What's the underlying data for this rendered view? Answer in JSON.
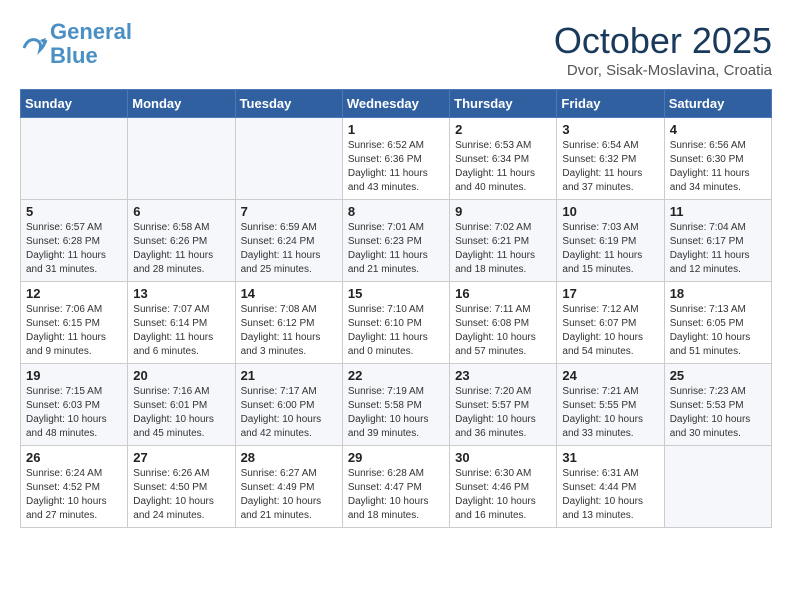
{
  "header": {
    "logo_line1": "General",
    "logo_line2": "Blue",
    "month": "October 2025",
    "location": "Dvor, Sisak-Moslavina, Croatia"
  },
  "weekdays": [
    "Sunday",
    "Monday",
    "Tuesday",
    "Wednesday",
    "Thursday",
    "Friday",
    "Saturday"
  ],
  "weeks": [
    [
      {
        "day": "",
        "info": ""
      },
      {
        "day": "",
        "info": ""
      },
      {
        "day": "",
        "info": ""
      },
      {
        "day": "1",
        "info": "Sunrise: 6:52 AM\nSunset: 6:36 PM\nDaylight: 11 hours and 43 minutes."
      },
      {
        "day": "2",
        "info": "Sunrise: 6:53 AM\nSunset: 6:34 PM\nDaylight: 11 hours and 40 minutes."
      },
      {
        "day": "3",
        "info": "Sunrise: 6:54 AM\nSunset: 6:32 PM\nDaylight: 11 hours and 37 minutes."
      },
      {
        "day": "4",
        "info": "Sunrise: 6:56 AM\nSunset: 6:30 PM\nDaylight: 11 hours and 34 minutes."
      }
    ],
    [
      {
        "day": "5",
        "info": "Sunrise: 6:57 AM\nSunset: 6:28 PM\nDaylight: 11 hours and 31 minutes."
      },
      {
        "day": "6",
        "info": "Sunrise: 6:58 AM\nSunset: 6:26 PM\nDaylight: 11 hours and 28 minutes."
      },
      {
        "day": "7",
        "info": "Sunrise: 6:59 AM\nSunset: 6:24 PM\nDaylight: 11 hours and 25 minutes."
      },
      {
        "day": "8",
        "info": "Sunrise: 7:01 AM\nSunset: 6:23 PM\nDaylight: 11 hours and 21 minutes."
      },
      {
        "day": "9",
        "info": "Sunrise: 7:02 AM\nSunset: 6:21 PM\nDaylight: 11 hours and 18 minutes."
      },
      {
        "day": "10",
        "info": "Sunrise: 7:03 AM\nSunset: 6:19 PM\nDaylight: 11 hours and 15 minutes."
      },
      {
        "day": "11",
        "info": "Sunrise: 7:04 AM\nSunset: 6:17 PM\nDaylight: 11 hours and 12 minutes."
      }
    ],
    [
      {
        "day": "12",
        "info": "Sunrise: 7:06 AM\nSunset: 6:15 PM\nDaylight: 11 hours and 9 minutes."
      },
      {
        "day": "13",
        "info": "Sunrise: 7:07 AM\nSunset: 6:14 PM\nDaylight: 11 hours and 6 minutes."
      },
      {
        "day": "14",
        "info": "Sunrise: 7:08 AM\nSunset: 6:12 PM\nDaylight: 11 hours and 3 minutes."
      },
      {
        "day": "15",
        "info": "Sunrise: 7:10 AM\nSunset: 6:10 PM\nDaylight: 11 hours and 0 minutes."
      },
      {
        "day": "16",
        "info": "Sunrise: 7:11 AM\nSunset: 6:08 PM\nDaylight: 10 hours and 57 minutes."
      },
      {
        "day": "17",
        "info": "Sunrise: 7:12 AM\nSunset: 6:07 PM\nDaylight: 10 hours and 54 minutes."
      },
      {
        "day": "18",
        "info": "Sunrise: 7:13 AM\nSunset: 6:05 PM\nDaylight: 10 hours and 51 minutes."
      }
    ],
    [
      {
        "day": "19",
        "info": "Sunrise: 7:15 AM\nSunset: 6:03 PM\nDaylight: 10 hours and 48 minutes."
      },
      {
        "day": "20",
        "info": "Sunrise: 7:16 AM\nSunset: 6:01 PM\nDaylight: 10 hours and 45 minutes."
      },
      {
        "day": "21",
        "info": "Sunrise: 7:17 AM\nSunset: 6:00 PM\nDaylight: 10 hours and 42 minutes."
      },
      {
        "day": "22",
        "info": "Sunrise: 7:19 AM\nSunset: 5:58 PM\nDaylight: 10 hours and 39 minutes."
      },
      {
        "day": "23",
        "info": "Sunrise: 7:20 AM\nSunset: 5:57 PM\nDaylight: 10 hours and 36 minutes."
      },
      {
        "day": "24",
        "info": "Sunrise: 7:21 AM\nSunset: 5:55 PM\nDaylight: 10 hours and 33 minutes."
      },
      {
        "day": "25",
        "info": "Sunrise: 7:23 AM\nSunset: 5:53 PM\nDaylight: 10 hours and 30 minutes."
      }
    ],
    [
      {
        "day": "26",
        "info": "Sunrise: 6:24 AM\nSunset: 4:52 PM\nDaylight: 10 hours and 27 minutes."
      },
      {
        "day": "27",
        "info": "Sunrise: 6:26 AM\nSunset: 4:50 PM\nDaylight: 10 hours and 24 minutes."
      },
      {
        "day": "28",
        "info": "Sunrise: 6:27 AM\nSunset: 4:49 PM\nDaylight: 10 hours and 21 minutes."
      },
      {
        "day": "29",
        "info": "Sunrise: 6:28 AM\nSunset: 4:47 PM\nDaylight: 10 hours and 18 minutes."
      },
      {
        "day": "30",
        "info": "Sunrise: 6:30 AM\nSunset: 4:46 PM\nDaylight: 10 hours and 16 minutes."
      },
      {
        "day": "31",
        "info": "Sunrise: 6:31 AM\nSunset: 4:44 PM\nDaylight: 10 hours and 13 minutes."
      },
      {
        "day": "",
        "info": ""
      }
    ]
  ]
}
